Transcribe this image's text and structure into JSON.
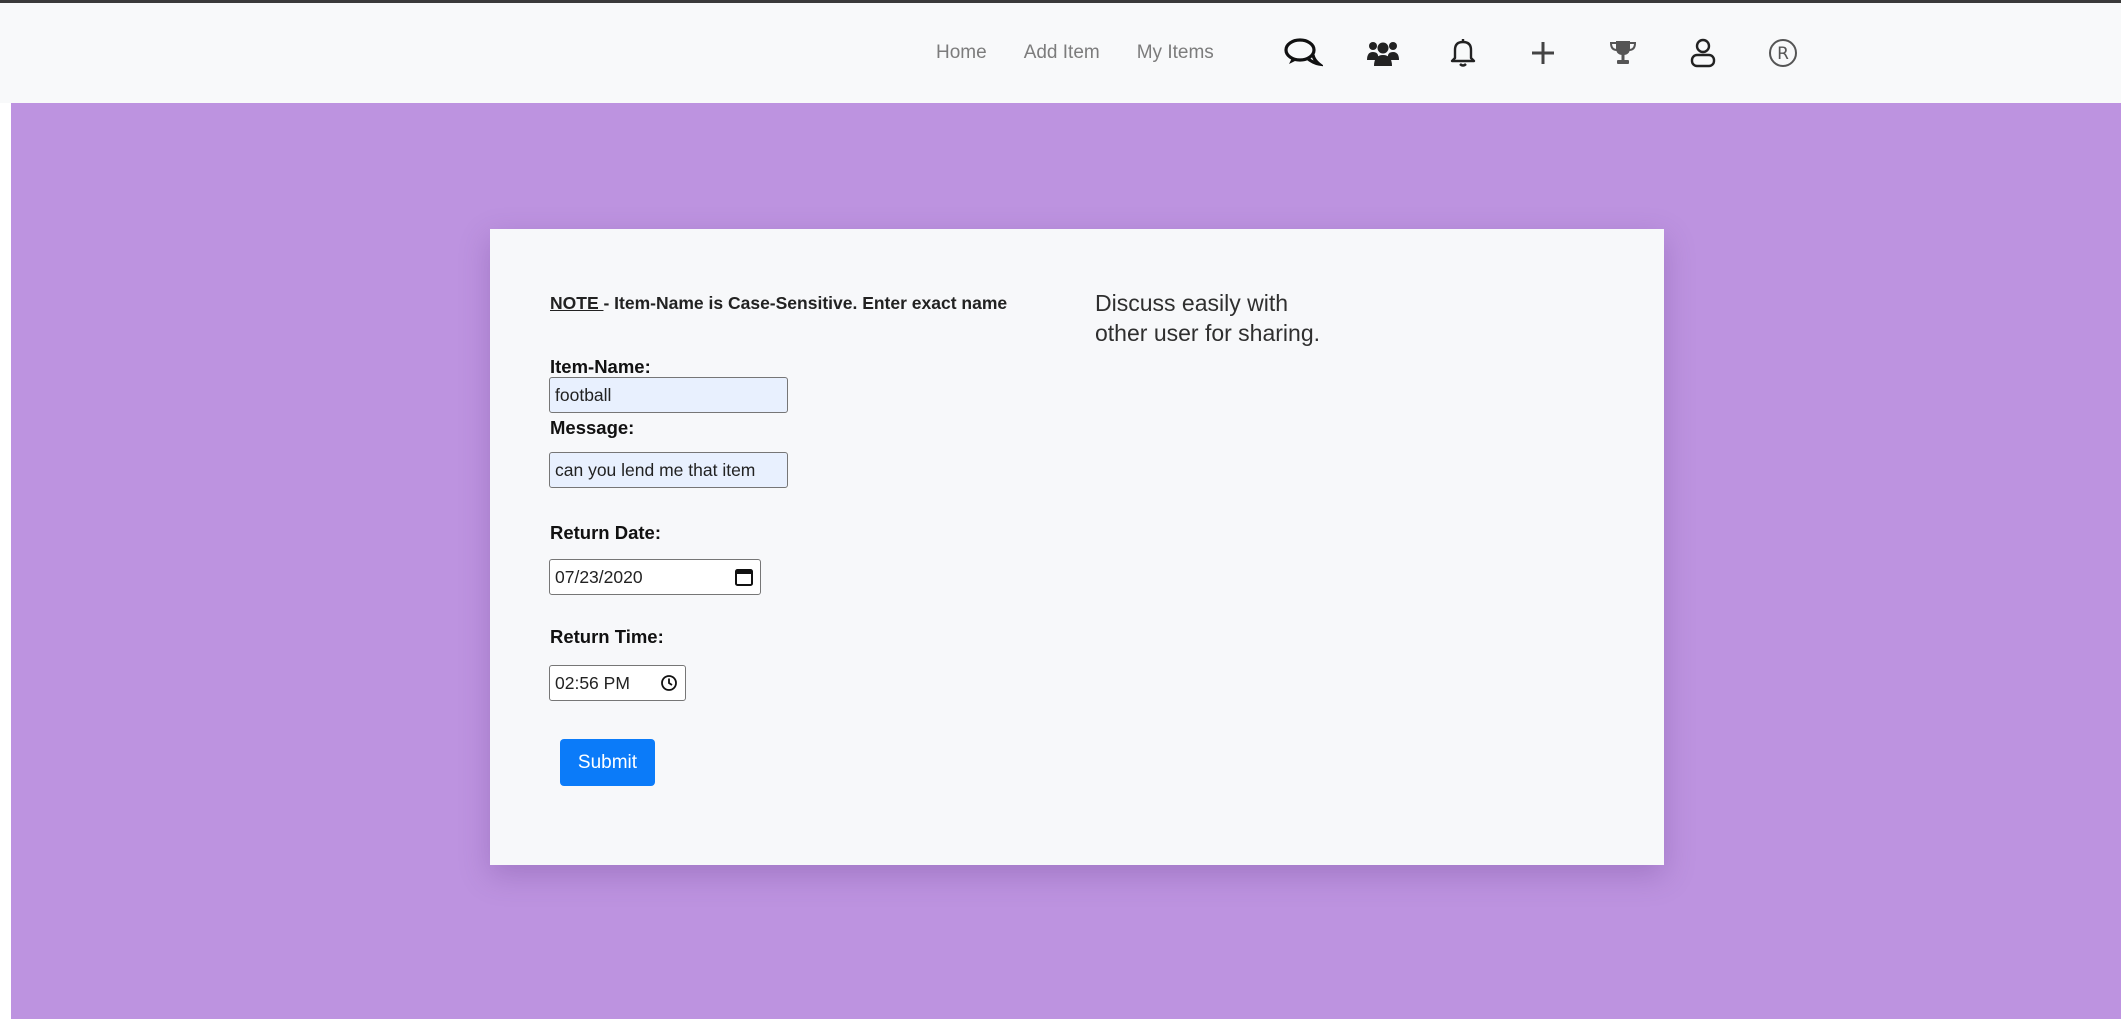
{
  "navbar": {
    "links": [
      {
        "label": "Home"
      },
      {
        "label": "Add Item"
      },
      {
        "label": "My Items"
      }
    ],
    "icons": [
      "chat-icon",
      "users-icon",
      "bell-icon",
      "plus-icon",
      "trophy-icon",
      "user-icon",
      "registered-icon"
    ],
    "registered_glyph": "®"
  },
  "colors": {
    "background": "#bd93e0",
    "navbar": "#f8f9fa",
    "card": "#f7f8fa",
    "submit": "#0b7bf9",
    "autofill": "#e8f0fe"
  },
  "form": {
    "note_key": "NOTE ",
    "note_text": "- Item-Name is Case-Sensitive. Enter exact name",
    "item_name_label": "Item-Name:",
    "item_name_value": "football",
    "message_label": "Message:",
    "message_value": "can you lend me that item",
    "return_date_label": "Return Date:",
    "return_date_value": "07/23/2020",
    "return_time_label": "Return Time:",
    "return_time_value": "02:56 PM",
    "submit_label": "Submit"
  },
  "side_text": "Discuss easily with other user for sharing."
}
